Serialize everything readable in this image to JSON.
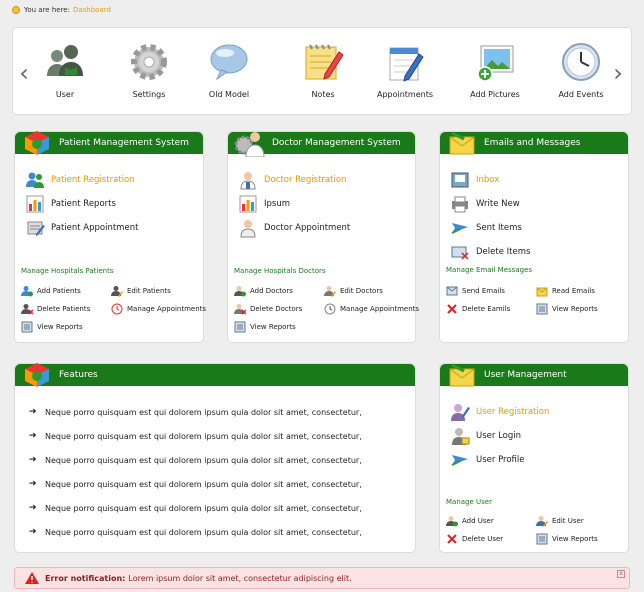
{
  "breadcrumb": {
    "prefix": "You are here:",
    "current": "Dashboard"
  },
  "toolbar": {
    "items": [
      {
        "label": "User",
        "icon": "user-group-icon"
      },
      {
        "label": "Settings",
        "icon": "gear-icon"
      },
      {
        "label": "Old Model",
        "icon": "speech-bubble-icon"
      },
      {
        "label": "Notes",
        "icon": "notepad-icon"
      },
      {
        "label": "Appointments",
        "icon": "calendar-pencil-icon"
      },
      {
        "label": "Add Pictures",
        "icon": "add-picture-icon"
      },
      {
        "label": "Add Events",
        "icon": "clock-icon"
      }
    ]
  },
  "patient": {
    "title": "Patient Management System",
    "links": [
      "Patient Registration",
      "Patient Reports",
      "Patient Appointment"
    ],
    "manage_title": "Manage Hospitals Patients",
    "actions": [
      "Add Patients",
      "Edit Patients",
      "Delete Patients",
      "Manage Appointments",
      "View Reports"
    ]
  },
  "doctor": {
    "title": "Doctor Management System",
    "links": [
      "Doctor Registration",
      "Ipsum",
      "Doctor Appointment"
    ],
    "manage_title": "Manage Hospitals Doctors",
    "actions": [
      "Add Doctors",
      "Edit Doctors",
      "Delete Doctors",
      "Manage Appointments",
      "View Reports"
    ]
  },
  "emails": {
    "title": "Emails and Messages",
    "links": [
      "Inbox",
      "Write New",
      "Sent Items",
      "Delete Items"
    ],
    "manage_title": "Manage Email Messages",
    "actions": [
      "Send Emails",
      "Read Emails",
      "Delete Eamils",
      "View Reports"
    ]
  },
  "features": {
    "title": "Features",
    "items": [
      "Neque porro quisquam est qui dolorem ipsum quia dolor sit amet, consectetur,",
      "Neque porro quisquam est qui dolorem ipsum quia dolor sit amet, consectetur,",
      "Neque porro quisquam est qui dolorem ipsum quia dolor sit amet, consectetur,",
      "Neque porro quisquam est qui dolorem ipsum quia dolor sit amet, consectetur,",
      "Neque porro quisquam est qui dolorem ipsum quia dolor sit amet, consectetur,",
      "Neque porro quisquam est qui dolorem ipsum quia dolor sit amet, consectetur,"
    ]
  },
  "users": {
    "title": "User Management",
    "links": [
      "User Registration",
      "User Login",
      "User Profile"
    ],
    "manage_title": "Manage User",
    "actions": [
      "Add User",
      "Edit User",
      "Delete User",
      "View Reports"
    ]
  },
  "notification": {
    "label": "Error notification:",
    "message": "Lorem ipsum dolor sit amet, consectetur adipiscing elit.",
    "close": "x"
  },
  "colors": {
    "header_green": "#1a7a1a",
    "link_active": "#e39b00",
    "error_bg": "#fbe3e4"
  }
}
